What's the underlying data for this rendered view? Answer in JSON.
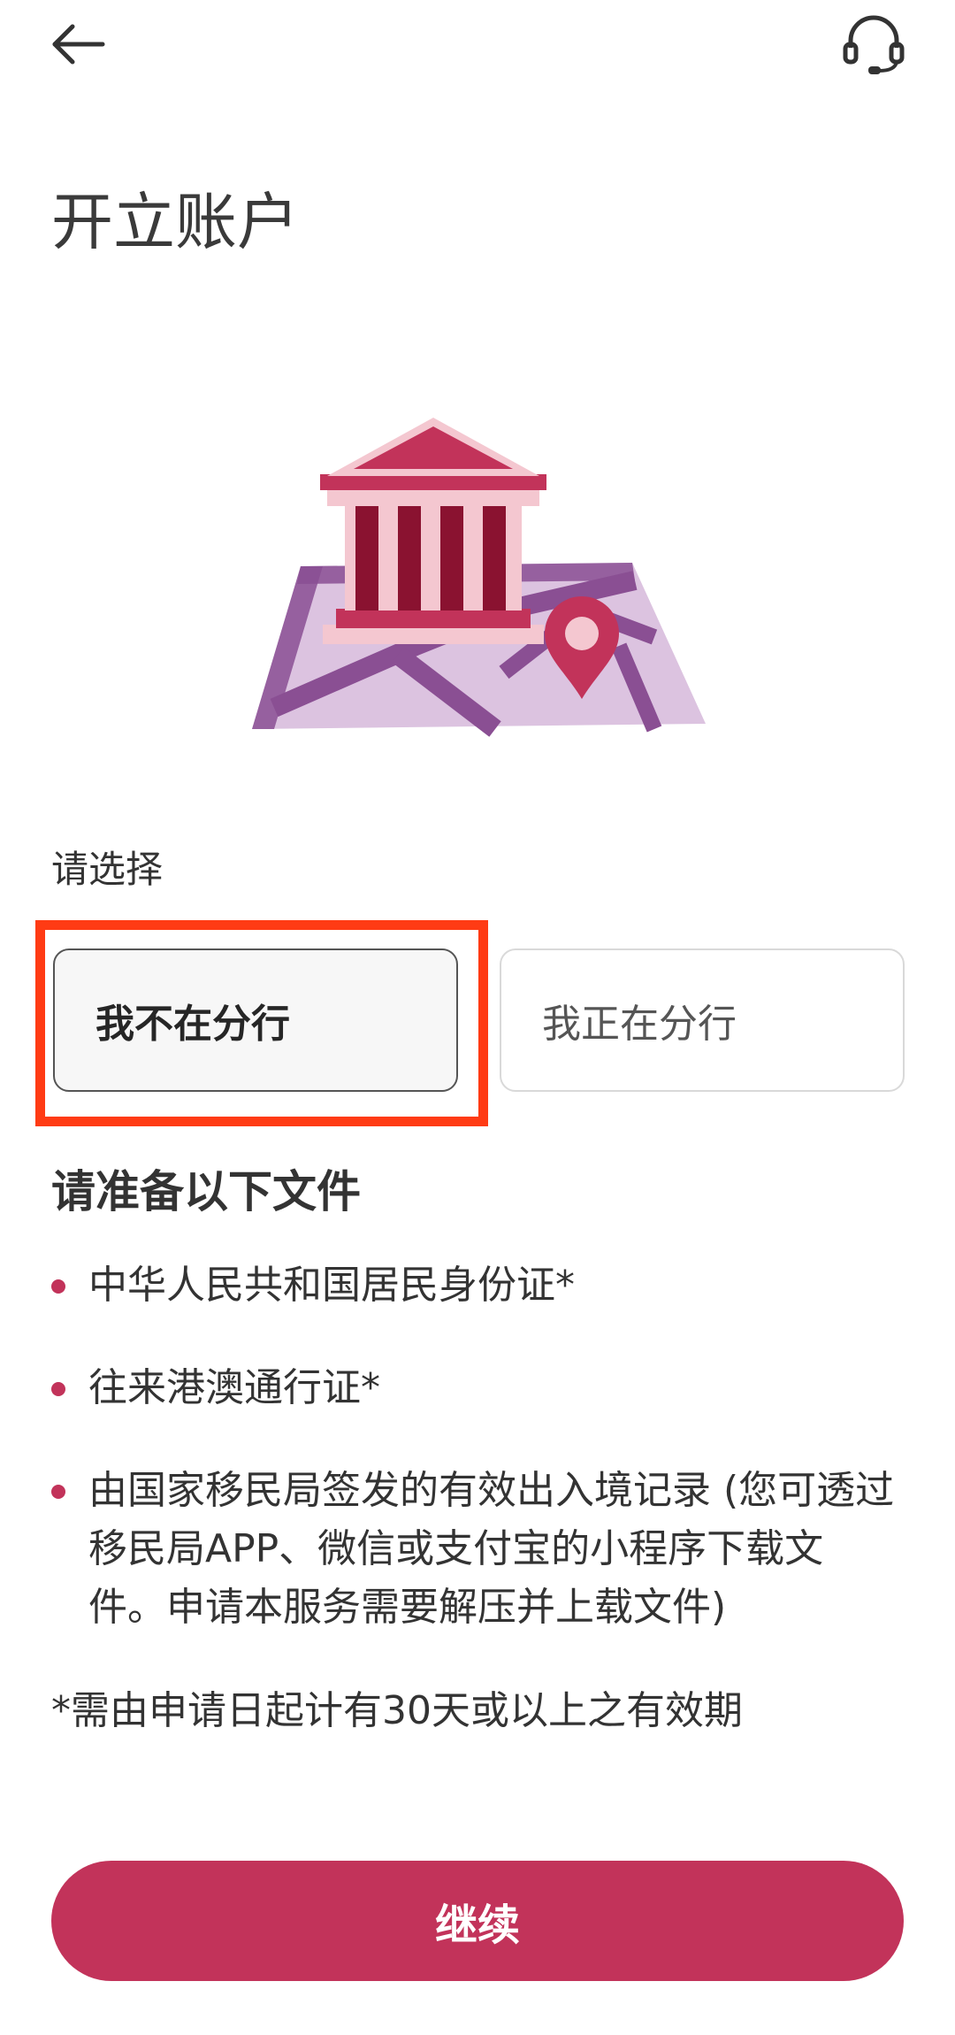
{
  "header": {
    "back_icon": "arrow-left-icon",
    "support_icon": "headset-icon"
  },
  "page": {
    "title": "开立账户"
  },
  "hero": {
    "icon": "bank-map-pin-illustration",
    "colors": {
      "primary": "#c2335a",
      "dark": "#8a1230",
      "light": "#f4c7d0",
      "map": "#dcc3e0",
      "map_dark": "#8a4f93"
    }
  },
  "selection": {
    "label": "请选择",
    "options": [
      {
        "label": "我不在分行",
        "selected": true
      },
      {
        "label": "我正在分行",
        "selected": false
      }
    ]
  },
  "documents": {
    "heading": "请准备以下文件",
    "items": [
      {
        "text": "中华人民共和国居民身份证*"
      },
      {
        "text": "往来港澳通行证*"
      },
      {
        "text": "由国家移民局签发的有效出入境记录 (您可透过移民局APP、微信或支付宝的小程序下载文件。申请本服务需要解压并上载文件)"
      }
    ],
    "footnote": "*需由申请日起计有30天或以上之有效期"
  },
  "footer": {
    "continue_label": "继续"
  },
  "colors": {
    "accent": "#c2335a",
    "highlight_box": "#ff3b14"
  }
}
